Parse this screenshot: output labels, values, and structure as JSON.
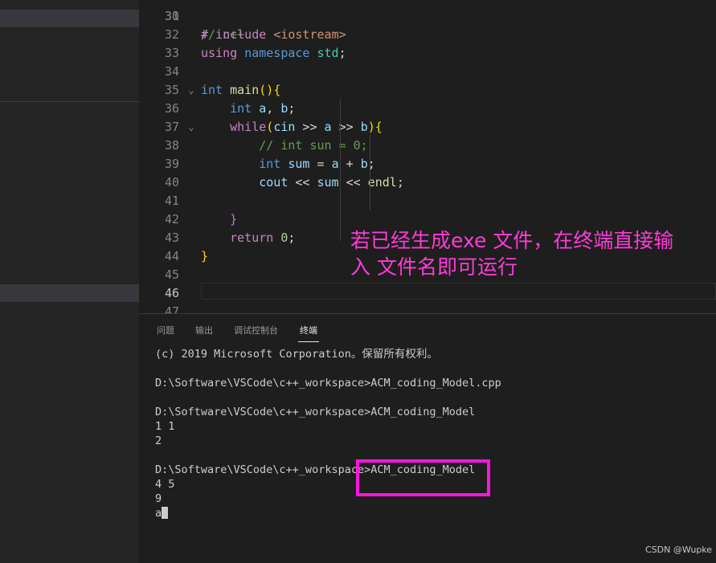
{
  "editor": {
    "lines": [
      {
        "n": "31",
        "code": ""
      },
      {
        "n": "32",
        "code": "# include <iostream>"
      },
      {
        "n": "33",
        "code": "using namespace std;"
      },
      {
        "n": "34",
        "code": ""
      },
      {
        "n": "35",
        "code": "int main(){"
      },
      {
        "n": "36",
        "code": "    int a, b;"
      },
      {
        "n": "37",
        "code": "    while(cin >> a >> b){"
      },
      {
        "n": "38",
        "code": "        // int sun = 0;"
      },
      {
        "n": "39",
        "code": "        int sum = a + b;"
      },
      {
        "n": "40",
        "code": "        cout << sum << endl;"
      },
      {
        "n": "41",
        "code": ""
      },
      {
        "n": "42",
        "code": "    }"
      },
      {
        "n": "43",
        "code": "    return 0;"
      },
      {
        "n": "44",
        "code": "}"
      },
      {
        "n": "45",
        "code": ""
      },
      {
        "n": "46",
        "code": ""
      },
      {
        "n": "47",
        "code": ""
      }
    ],
    "current_line": "46"
  },
  "annotation": {
    "line1": "若已经生成exe 文件，在终端直接输",
    "line2": "入 文件名即可运行"
  },
  "panel": {
    "tabs": [
      "问题",
      "输出",
      "调试控制台",
      "终端"
    ],
    "active_tab": "终端",
    "terminal_lines": [
      "(c) 2019 Microsoft Corporation。保留所有权利。",
      "",
      "D:\\Software\\VSCode\\c++_workspace>ACM_coding_Model.cpp",
      "",
      "D:\\Software\\VSCode\\c++_workspace>ACM_coding_Model",
      "1 1",
      "2",
      "",
      "D:\\Software\\VSCode\\c++_workspace>ACM_coding_Model",
      "4 5",
      "9",
      "a"
    ]
  },
  "watermark": "CSDN @Wupke",
  "colors": {
    "highlight_box": "#ff14e0",
    "annotation_text": "#ff3ad8"
  }
}
